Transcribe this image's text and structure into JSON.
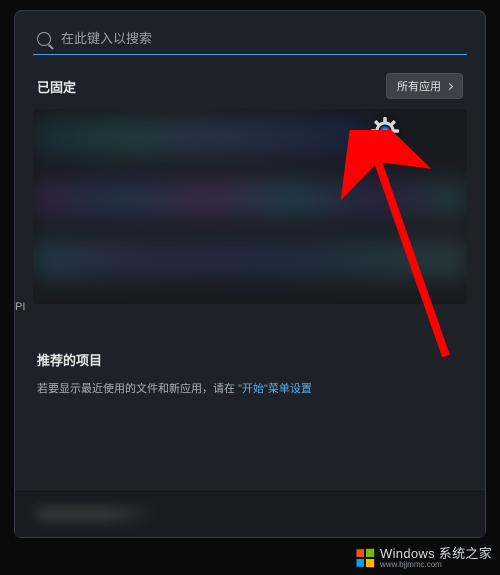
{
  "search": {
    "placeholder": "在此键入以搜索"
  },
  "pinned": {
    "title": "已固定",
    "all_apps": "所有应用",
    "settings_label": "设置"
  },
  "p_label": "PI",
  "recommended": {
    "title": "推荐的项目",
    "text_prefix": "若要显示最近使用的文件和新应用，请在",
    "link_text": "\"开始\"菜单设置",
    "text_suffix": ""
  },
  "watermark": {
    "main": "Windows 系统之家",
    "sub": "www.bjjmmc.com"
  }
}
